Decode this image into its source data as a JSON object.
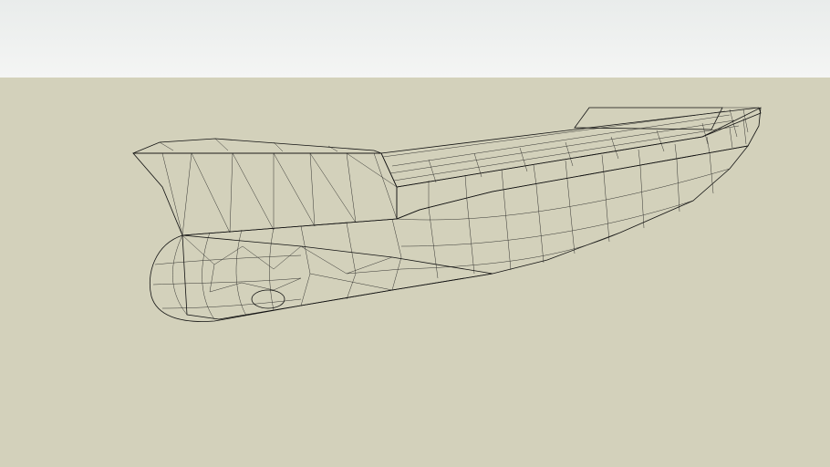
{
  "scene": {
    "sky_color_top": "#e9eceb",
    "sky_color_bottom": "#f4f5f4",
    "ground_color": "#d3d1bb",
    "hull_red": "#ff0000",
    "hull_red_dark": "#c10000",
    "deck_red": "#9c1010",
    "bulwark_gray": "#3c3c3c",
    "edge_color": "#111111",
    "model_subject": "ship-hull"
  }
}
